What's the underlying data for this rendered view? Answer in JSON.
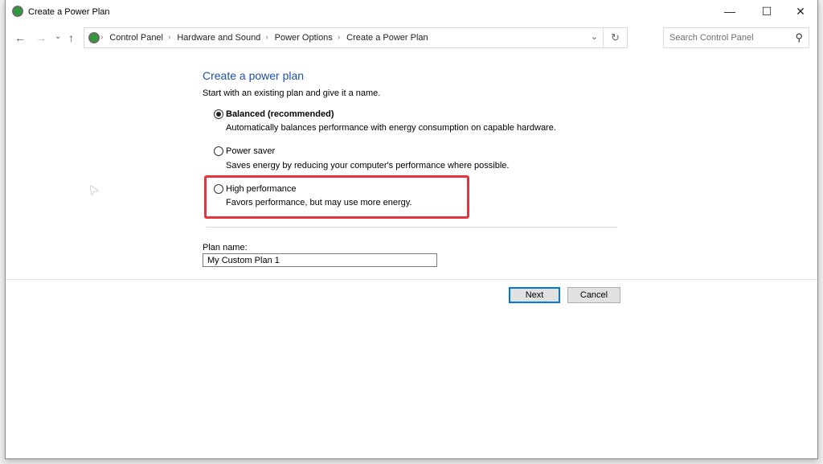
{
  "window": {
    "title": "Create a Power Plan",
    "minimize": "—",
    "maximize": "☐",
    "close": "✕"
  },
  "nav": {
    "back": "←",
    "forward": "→",
    "recent": "⌄",
    "up": "↑"
  },
  "address": {
    "crumbs": [
      "Control Panel",
      "Hardware and Sound",
      "Power Options",
      "Create a Power Plan"
    ],
    "separator": "›",
    "dropdown": "⌄",
    "refresh": "↻"
  },
  "search": {
    "placeholder": "Search Control Panel",
    "icon": "⚲"
  },
  "main": {
    "heading": "Create a power plan",
    "subtitle": "Start with an existing plan and give it a name.",
    "plans": [
      {
        "label": "Balanced (recommended)",
        "desc": "Automatically balances performance with energy consumption on capable hardware.",
        "selected": true
      },
      {
        "label": "Power saver",
        "desc": "Saves energy by reducing your computer's performance where possible.",
        "selected": false
      },
      {
        "label": "High performance",
        "desc": "Favors performance, but may use more energy.",
        "selected": false
      }
    ],
    "highlight_color": "#e8333b",
    "plan_name_label": "Plan name:",
    "plan_name_value": "My Custom Plan 1",
    "next": "Next",
    "cancel": "Cancel"
  }
}
